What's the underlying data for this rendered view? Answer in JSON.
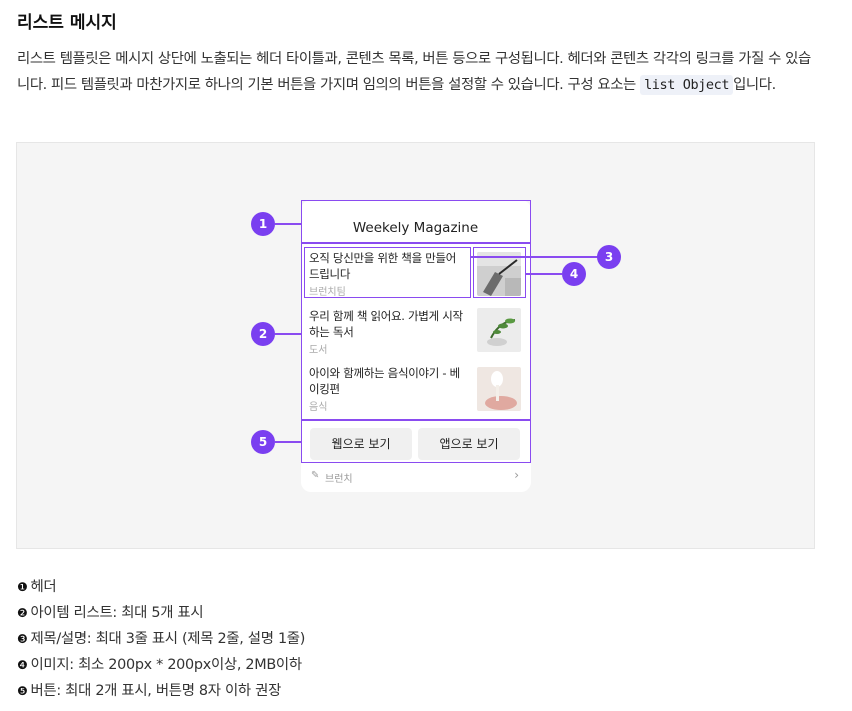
{
  "title": "리스트 메시지",
  "description": {
    "text": "리스트 템플릿은 메시지 상단에 노출되는 헤더 타이틀과, 콘텐츠 목록, 버튼 등으로 구성됩니다. 헤더와 콘텐츠 각각의 링크를 가질 수 있습니다. 피드 템플릿과 마찬가지로 하나의 기본 버튼을 가지며 임의의 버튼을 설정할 수 있습니다. 구성 요소는",
    "code": "list Object",
    "suffix": "입니다."
  },
  "preview": {
    "header_title": "Weekely Magazine",
    "items": [
      {
        "title": "오직 당신만을 위한 책을 만들어 드립니다",
        "desc": "브런치팀"
      },
      {
        "title": "우리 함께 책 읽어요. 가볍게 시작하는 독서",
        "desc": "도서"
      },
      {
        "title": "아이와 함께하는 음식이야기 - 베이킹편",
        "desc": "음식"
      }
    ],
    "buttons": [
      "웹으로 보기",
      "앱으로 보기"
    ],
    "footer_label": "브런치",
    "footer_icon": "brunch-pen-icon"
  },
  "callouts": [
    "1",
    "2",
    "3",
    "4",
    "5"
  ],
  "legend": [
    {
      "num": "❶",
      "text": "헤더"
    },
    {
      "num": "❷",
      "text": "아이템 리스트: 최대 5개 표시"
    },
    {
      "num": "❸",
      "text": "제목/설명: 최대 3줄 표시 (제목 2줄, 설명 1줄)"
    },
    {
      "num": "❹",
      "text": "이미지: 최소 200px * 200px이상, 2MB이하"
    },
    {
      "num": "❺",
      "text": "버튼: 최대 2개 표시, 버튼명 8자 이하 권장"
    }
  ],
  "colors": {
    "accent": "#7a3ff0",
    "outline": "#8a4bf0",
    "figure_bg": "#f5f5f5"
  }
}
